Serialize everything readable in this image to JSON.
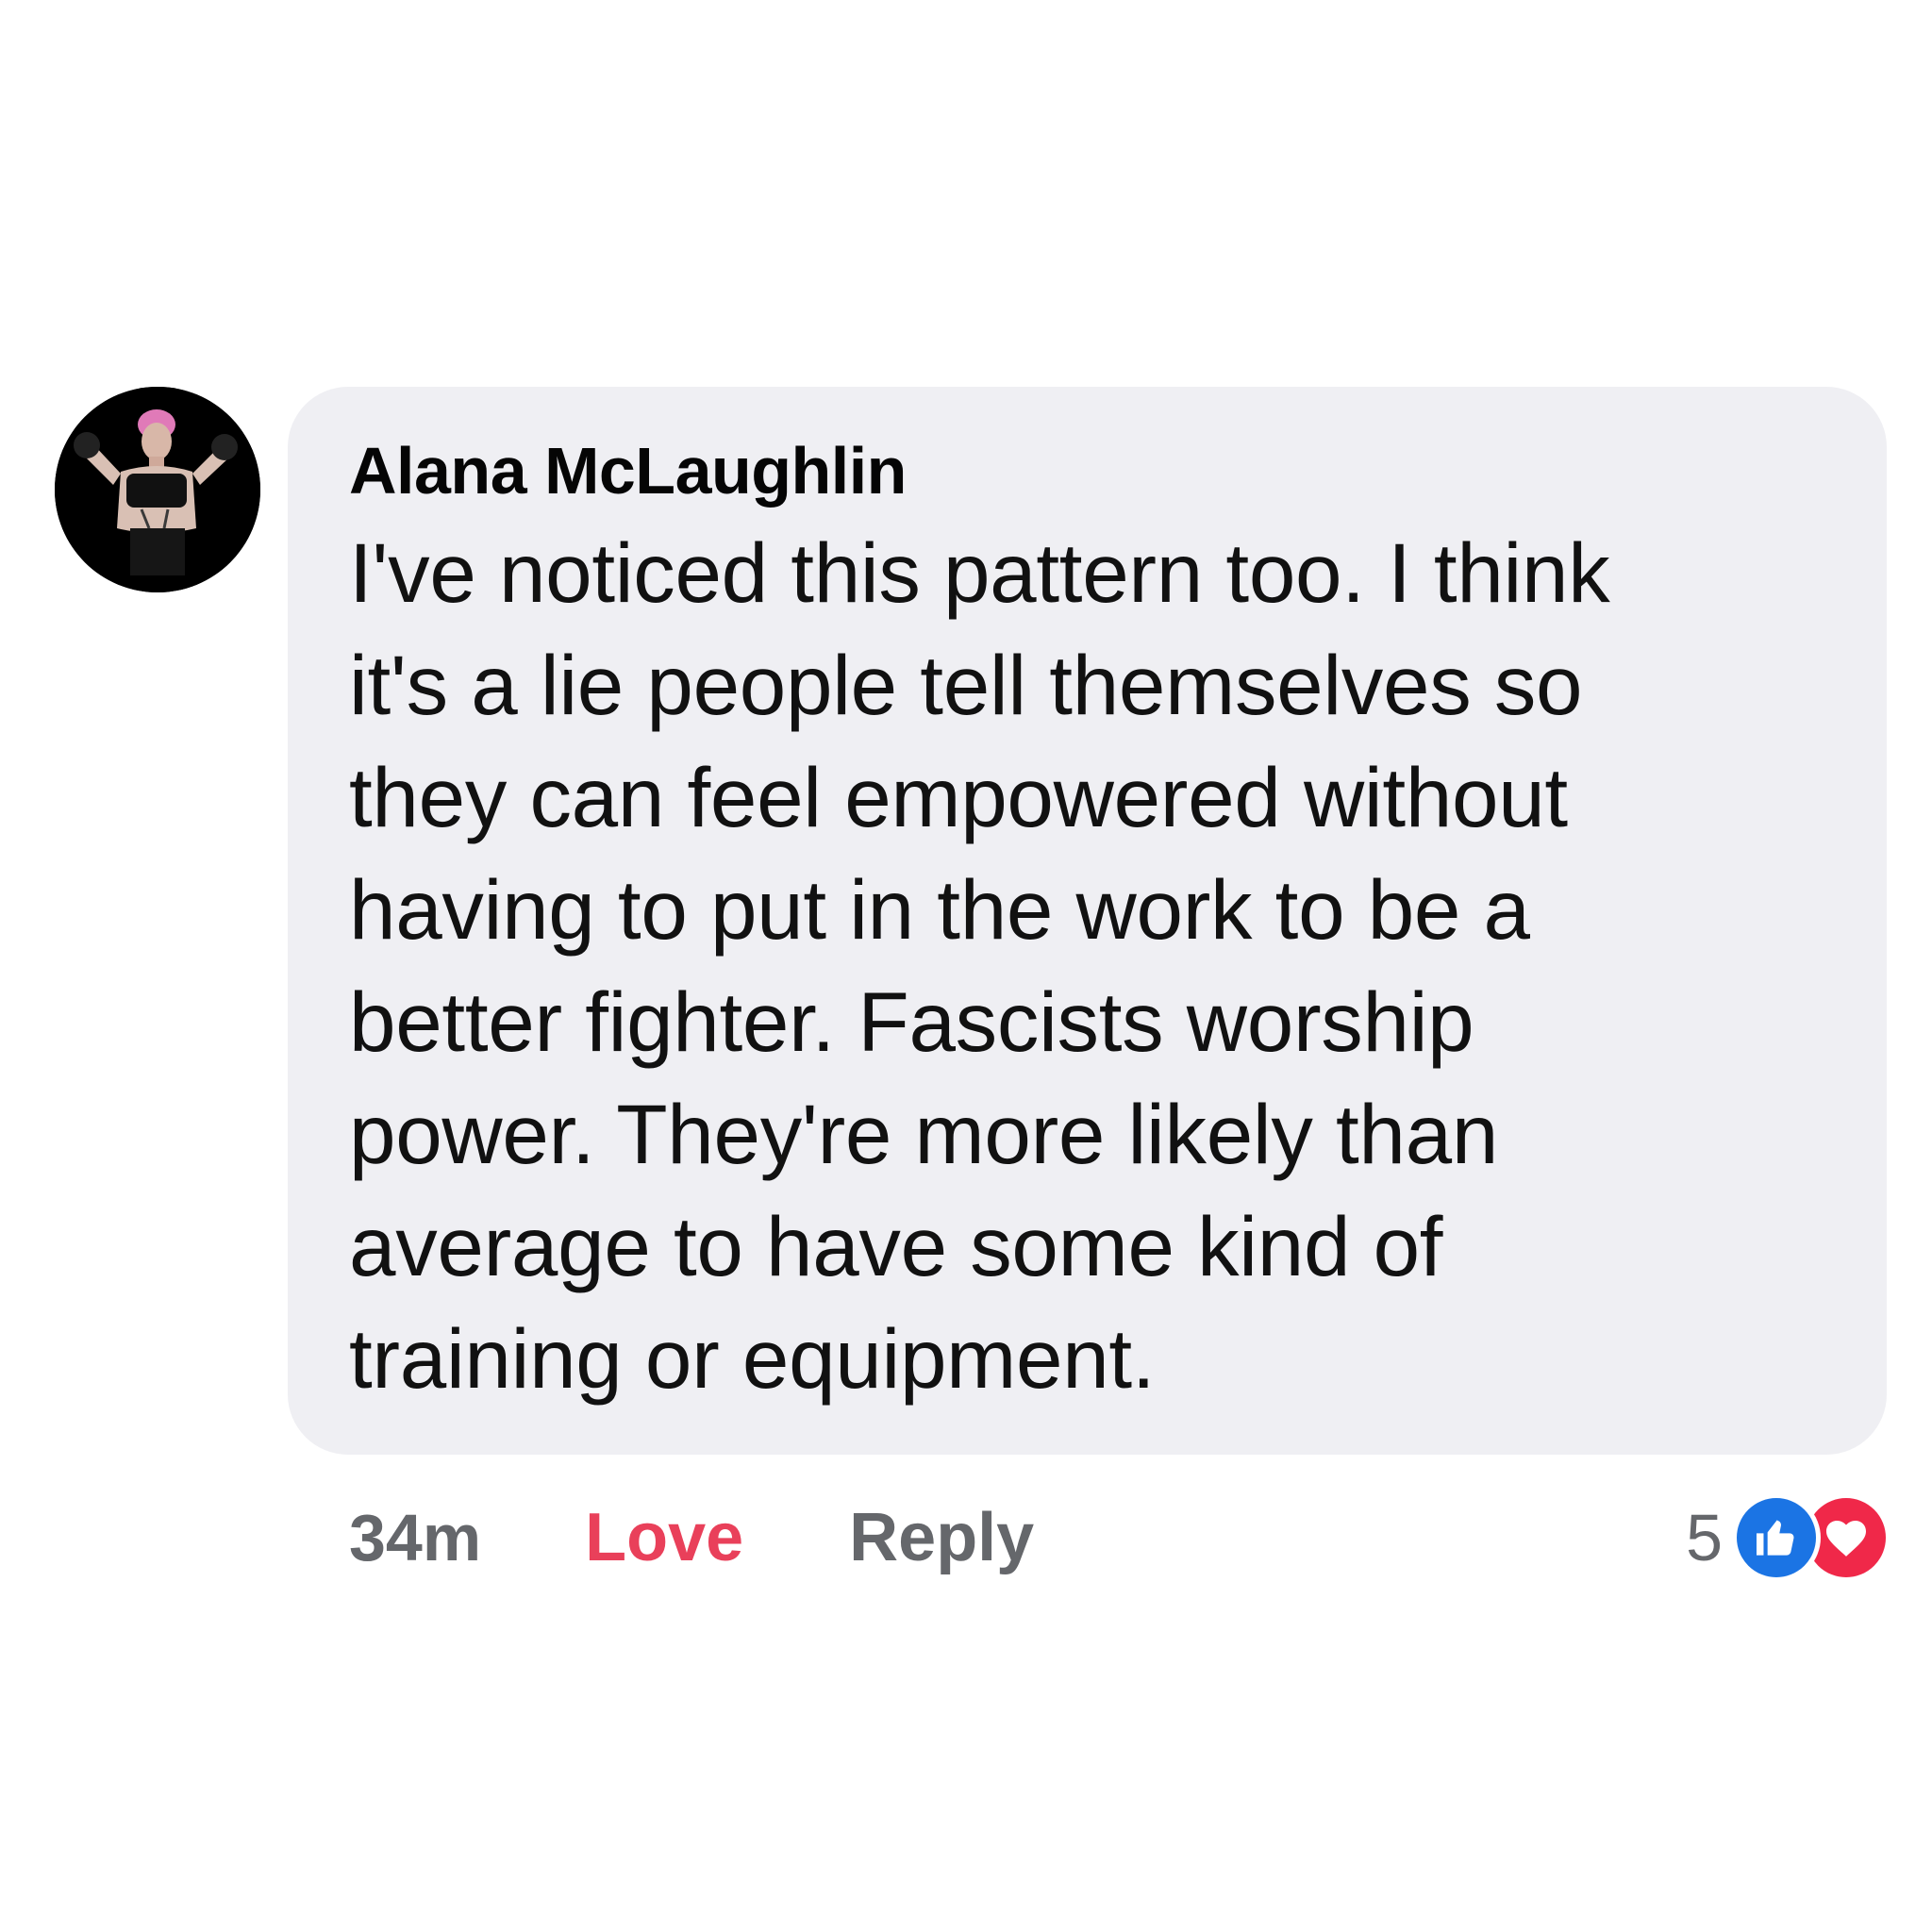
{
  "comment": {
    "author": "Alana McLaughlin",
    "text": "I've noticed this pattern too. I think\nit's a lie people tell themselves so\nthey can feel empowered without\nhaving to put in the work to be a\nbetter fighter. Fascists worship\npower. They're more likely than\naverage to have some kind of\ntraining or equipment."
  },
  "actions": {
    "timestamp": "34m",
    "love_label": "Love",
    "reply_label": "Reply"
  },
  "reactions": {
    "count": "5",
    "icons": [
      "like-icon",
      "love-icon"
    ]
  },
  "colors": {
    "bubble_bg": "#efeff3",
    "love": "#e9405a",
    "meta_gray": "#65676b",
    "like_blue": "#1b74e4",
    "love_red": "#f02849"
  }
}
